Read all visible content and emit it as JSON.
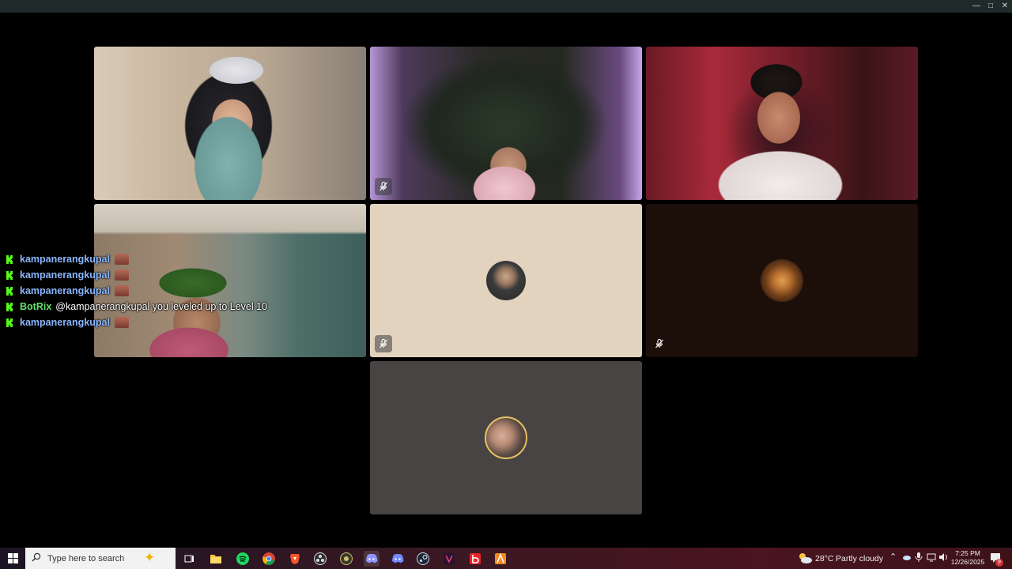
{
  "window": {
    "controls": [
      "minimize",
      "maximize",
      "close"
    ]
  },
  "tiles": [
    {
      "id": "cam-1",
      "type": "camera",
      "muted": false
    },
    {
      "id": "cam-2",
      "type": "camera",
      "muted": true
    },
    {
      "id": "cam-3",
      "type": "camera",
      "muted": false
    },
    {
      "id": "cam-4",
      "type": "camera",
      "muted": false
    },
    {
      "id": "avatar-1",
      "type": "avatar",
      "muted": true,
      "bg": "#e1d3be"
    },
    {
      "id": "avatar-2",
      "type": "avatar",
      "muted": true,
      "bg": "#1c0f09"
    },
    {
      "id": "avatar-3",
      "type": "avatar",
      "muted": false,
      "bg": "#474443"
    }
  ],
  "chat": {
    "lines": [
      {
        "user": "kampanerangkupal",
        "message": "",
        "emote": true,
        "bot": false
      },
      {
        "user": "kampanerangkupal",
        "message": "",
        "emote": true,
        "bot": false
      },
      {
        "user": "kampanerangkupal",
        "message": "",
        "emote": true,
        "bot": false
      },
      {
        "user": "BotRix",
        "message": "@kampanerangkupal you leveled up to Level 10",
        "emote": false,
        "bot": true
      },
      {
        "user": "kampanerangkupal",
        "message": "",
        "emote": true,
        "bot": false
      }
    ],
    "colors": {
      "user": "#8ab6ff",
      "bot": "#62e36a",
      "kick": "#53fc18"
    }
  },
  "taskbar": {
    "search_placeholder": "Type here to search",
    "apps": [
      "task-view",
      "file-explorer",
      "spotify",
      "chrome",
      "brave",
      "obs",
      "app-extra",
      "discord-ptb",
      "discord",
      "steam",
      "vscode-like",
      "brand-app",
      "aim-app"
    ],
    "weather": {
      "temp": "28°C",
      "condition": "Partly cloudy"
    },
    "clock": {
      "time": "7:25 PM",
      "date": "12/26/2025"
    },
    "notifications": "9"
  }
}
